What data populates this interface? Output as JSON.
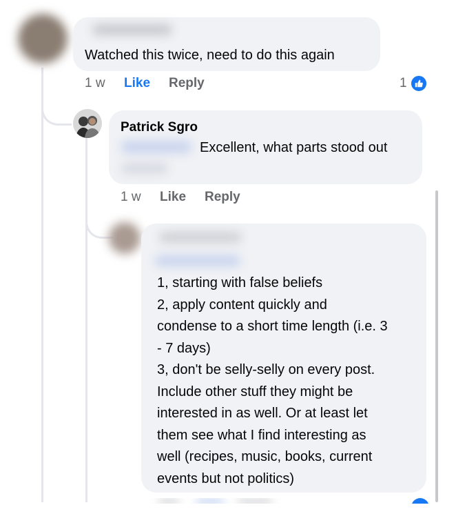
{
  "comment1": {
    "text": "Watched this twice,  need to do this again",
    "time": "1 w",
    "like_label": "Like",
    "reply_label": "Reply",
    "reaction_count": "1"
  },
  "comment2": {
    "author": "Patrick Sgro",
    "text": "Excellent, what parts stood out",
    "time": "1 w",
    "like_label": "Like",
    "reply_label": "Reply"
  },
  "comment3": {
    "lines": [
      "1, starting with false beliefs",
      "2, apply content quickly and",
      "condense to a short time length (i.e. 3",
      "- 7 days)",
      "3, don't be selly-selly on every post.",
      "Include other stuff they might be",
      "interested in as well. Or at least let",
      "them see what I find interesting as",
      "well (recipes, music, books, current",
      "events  but not politics)"
    ]
  },
  "colors": {
    "bubble": "#f0f2f5",
    "accent": "#1877f2",
    "meta_text": "#65676b"
  }
}
